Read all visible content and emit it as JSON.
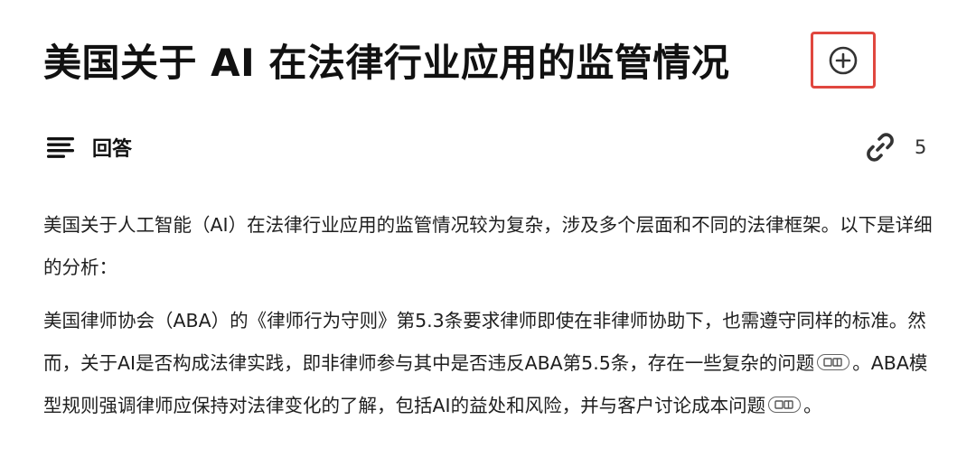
{
  "title": "美国关于 AI 在法律行业应用的监管情况",
  "header": {
    "answer_label": "回答",
    "source_count": "5"
  },
  "paragraphs": {
    "p1": "美国关于人工智能（AI）在法律行业应用的监管情况较为复杂，涉及多个层面和不同的法律框架。以下是详细的分析：",
    "p2_part1": "美国律师协会（ABA）的《律师行为守则》第5.3条要求律师即使在非律师协助下，也需遵守同样的标准。然而，关于AI是否构成法律实践，即非律师参与其中是否违反ABA第5.5条，存在一些复杂的问题",
    "p2_part2": "。ABA模型规则强调律师应保持对法律变化的了解，包括AI的益处和风险，并与客户讨论成本问题",
    "p2_part3": "。"
  },
  "icons": {
    "add": "plus-circle-icon",
    "answer": "text-lines-icon",
    "sources": "link-icon",
    "citation": "citation-icon"
  },
  "colors": {
    "highlight_border": "#e0473f",
    "text": "#1f1f1f"
  }
}
